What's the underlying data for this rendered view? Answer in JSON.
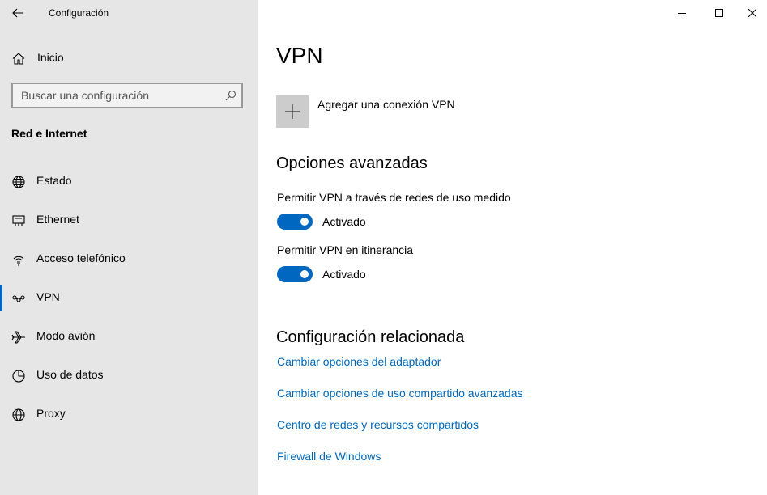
{
  "window": {
    "title": "Configuración"
  },
  "sidebar": {
    "home_label": "Inicio",
    "search_placeholder": "Buscar una configuración",
    "section_title": "Red e Internet",
    "items": [
      {
        "label": "Estado",
        "icon": "globe-status-icon"
      },
      {
        "label": "Ethernet",
        "icon": "ethernet-icon"
      },
      {
        "label": "Acceso telefónico",
        "icon": "dialup-icon"
      },
      {
        "label": "VPN",
        "icon": "vpn-icon",
        "active": true
      },
      {
        "label": "Modo avión",
        "icon": "airplane-icon"
      },
      {
        "label": "Uso de datos",
        "icon": "data-usage-icon"
      },
      {
        "label": "Proxy",
        "icon": "globe-icon"
      }
    ]
  },
  "main": {
    "title": "VPN",
    "add_vpn_label": "Agregar una conexión VPN",
    "advanced": {
      "heading": "Opciones avanzadas",
      "options": [
        {
          "label": "Permitir VPN a través de redes de uso medido",
          "state": "Activado",
          "on": true
        },
        {
          "label": "Permitir VPN en itinerancia",
          "state": "Activado",
          "on": true
        }
      ]
    },
    "related": {
      "heading": "Configuración relacionada",
      "links": [
        "Cambiar opciones del adaptador",
        "Cambiar opciones de uso compartido avanzadas",
        "Centro de redes y recursos compartidos",
        "Firewall de Windows"
      ]
    }
  },
  "colors": {
    "accent": "#0067c0",
    "link": "#0067b8",
    "sidebar_bg": "#e6e6e6"
  }
}
